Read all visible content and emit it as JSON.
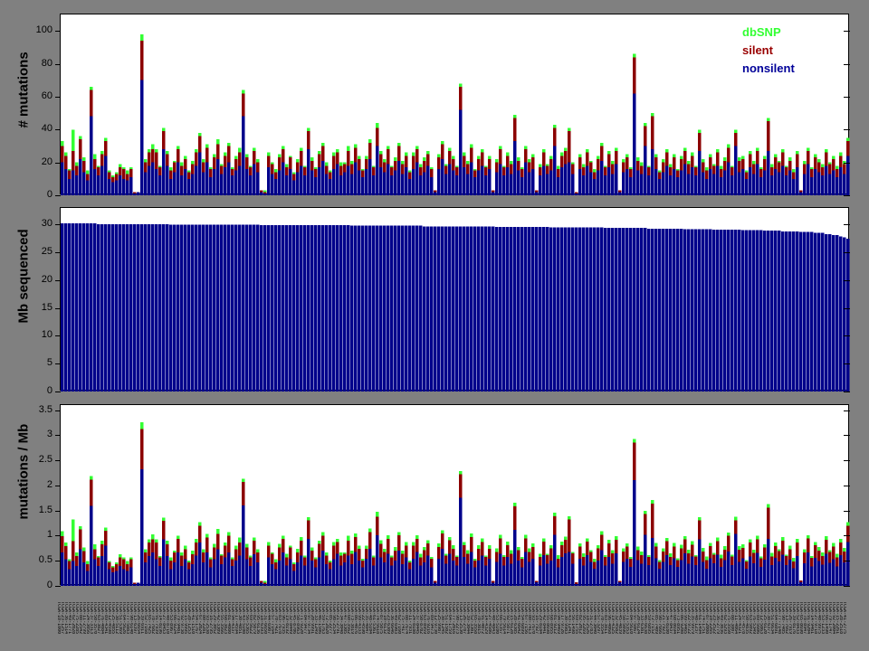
{
  "figure": {
    "background_color": "#808080",
    "plot_background_color": "#ffffff",
    "axis_color": "#000000"
  },
  "legend": {
    "items": [
      {
        "label": "dbSNP",
        "color": "#33ff33"
      },
      {
        "label": "silent",
        "color": "#990000"
      },
      {
        "label": "nonsilent",
        "color": "#000099"
      }
    ]
  },
  "x_axis": {
    "tick_labels_legible": false,
    "appearance": "dense 90-degree rotated per-sample identifiers, too small to read",
    "placeholder_prefix": "TCGA-"
  },
  "chart_data": [
    {
      "type": "bar",
      "stacked": true,
      "ylabel": "# mutations",
      "ylim": [
        0,
        110
      ],
      "yticks": [
        0,
        20,
        40,
        60,
        80,
        100
      ],
      "grid": false,
      "legend_position": "top-right inside axes, text only",
      "series_order": [
        "nonsilent",
        "silent",
        "dbSNP"
      ],
      "colors": {
        "nonsilent": "#00008b",
        "silent": "#8b0000",
        "dbSNP": "#33ff33"
      },
      "bars_format": "[nonsilent, silent, dbSNP] stacked counts per sample",
      "bars": [
        [
          20,
          10,
          3
        ],
        [
          16,
          8,
          2
        ],
        [
          10,
          5,
          1
        ],
        [
          15,
          12,
          13
        ],
        [
          12,
          6,
          2
        ],
        [
          22,
          12,
          2
        ],
        [
          14,
          7,
          2
        ],
        [
          9,
          4,
          2
        ],
        [
          48,
          16,
          2
        ],
        [
          16,
          6,
          3
        ],
        [
          12,
          5,
          1
        ],
        [
          18,
          7,
          2
        ],
        [
          24,
          9,
          2
        ],
        [
          10,
          4,
          1
        ],
        [
          8,
          3,
          1
        ],
        [
          9,
          4,
          1
        ],
        [
          12,
          5,
          2
        ],
        [
          10,
          6,
          1
        ],
        [
          9,
          4,
          2
        ],
        [
          11,
          5,
          1
        ],
        [
          1,
          1,
          0
        ],
        [
          2,
          0,
          0
        ],
        [
          70,
          24,
          4
        ],
        [
          14,
          6,
          2
        ],
        [
          18,
          8,
          2
        ],
        [
          20,
          8,
          3
        ],
        [
          16,
          10,
          2
        ],
        [
          12,
          5,
          1
        ],
        [
          28,
          11,
          2
        ],
        [
          18,
          7,
          2
        ],
        [
          10,
          5,
          2
        ],
        [
          14,
          6,
          1
        ],
        [
          20,
          8,
          2
        ],
        [
          12,
          6,
          2
        ],
        [
          16,
          6,
          2
        ],
        [
          10,
          4,
          1
        ],
        [
          13,
          6,
          2
        ],
        [
          18,
          8,
          2
        ],
        [
          26,
          10,
          2
        ],
        [
          14,
          6,
          2
        ],
        [
          20,
          9,
          2
        ],
        [
          11,
          5,
          1
        ],
        [
          16,
          7,
          2
        ],
        [
          22,
          9,
          3
        ],
        [
          13,
          5,
          1
        ],
        [
          17,
          7,
          2
        ],
        [
          20,
          10,
          2
        ],
        [
          12,
          4,
          1
        ],
        [
          15,
          7,
          2
        ],
        [
          18,
          8,
          3
        ],
        [
          48,
          14,
          2
        ],
        [
          16,
          7,
          2
        ],
        [
          12,
          5,
          1
        ],
        [
          19,
          8,
          2
        ],
        [
          14,
          6,
          2
        ],
        [
          2,
          1,
          0
        ],
        [
          1,
          1,
          1
        ],
        [
          17,
          7,
          2
        ],
        [
          13,
          6,
          1
        ],
        [
          10,
          4,
          2
        ],
        [
          15,
          8,
          2
        ],
        [
          20,
          8,
          2
        ],
        [
          12,
          5,
          2
        ],
        [
          16,
          7,
          1
        ],
        [
          9,
          4,
          1
        ],
        [
          14,
          6,
          2
        ],
        [
          18,
          9,
          2
        ],
        [
          12,
          5,
          1
        ],
        [
          28,
          11,
          2
        ],
        [
          15,
          6,
          2
        ],
        [
          11,
          5,
          1
        ],
        [
          17,
          8,
          2
        ],
        [
          21,
          9,
          2
        ],
        [
          13,
          5,
          2
        ],
        [
          10,
          4,
          1
        ],
        [
          16,
          8,
          2
        ],
        [
          19,
          7,
          2
        ],
        [
          12,
          6,
          2
        ],
        [
          14,
          5,
          1
        ],
        [
          18,
          9,
          3
        ],
        [
          13,
          6,
          2
        ],
        [
          20,
          9,
          2
        ],
        [
          15,
          7,
          2
        ],
        [
          11,
          4,
          1
        ],
        [
          16,
          6,
          2
        ],
        [
          22,
          10,
          2
        ],
        [
          12,
          5,
          1
        ],
        [
          30,
          11,
          3
        ],
        [
          17,
          8,
          2
        ],
        [
          14,
          6,
          2
        ],
        [
          19,
          9,
          2
        ],
        [
          12,
          5,
          1
        ],
        [
          15,
          6,
          2
        ],
        [
          21,
          9,
          2
        ],
        [
          13,
          6,
          2
        ],
        [
          17,
          7,
          2
        ],
        [
          10,
          4,
          1
        ],
        [
          16,
          8,
          2
        ],
        [
          20,
          8,
          2
        ],
        [
          12,
          5,
          2
        ],
        [
          14,
          7,
          2
        ],
        [
          18,
          7,
          2
        ],
        [
          11,
          5,
          1
        ],
        [
          2,
          1,
          0
        ],
        [
          16,
          7,
          2
        ],
        [
          22,
          9,
          2
        ],
        [
          13,
          5,
          1
        ],
        [
          19,
          8,
          2
        ],
        [
          15,
          7,
          2
        ],
        [
          12,
          5,
          1
        ],
        [
          52,
          14,
          2
        ],
        [
          17,
          7,
          2
        ],
        [
          13,
          6,
          2
        ],
        [
          20,
          9,
          2
        ],
        [
          11,
          4,
          1
        ],
        [
          15,
          7,
          2
        ],
        [
          18,
          8,
          2
        ],
        [
          12,
          5,
          1
        ],
        [
          16,
          6,
          2
        ],
        [
          2,
          1,
          0
        ],
        [
          14,
          6,
          2
        ],
        [
          19,
          9,
          2
        ],
        [
          12,
          5,
          1
        ],
        [
          17,
          7,
          2
        ],
        [
          13,
          6,
          2
        ],
        [
          33,
          14,
          2
        ],
        [
          15,
          6,
          2
        ],
        [
          11,
          5,
          1
        ],
        [
          20,
          8,
          2
        ],
        [
          14,
          6,
          2
        ],
        [
          16,
          7,
          2
        ],
        [
          2,
          1,
          0
        ],
        [
          12,
          5,
          2
        ],
        [
          18,
          8,
          2
        ],
        [
          13,
          5,
          1
        ],
        [
          15,
          7,
          2
        ],
        [
          30,
          11,
          2
        ],
        [
          11,
          5,
          2
        ],
        [
          17,
          7,
          2
        ],
        [
          19,
          8,
          2
        ],
        [
          20,
          19,
          2
        ],
        [
          13,
          6,
          1
        ],
        [
          1,
          1,
          0
        ],
        [
          16,
          7,
          2
        ],
        [
          12,
          5,
          2
        ],
        [
          18,
          8,
          2
        ],
        [
          14,
          6,
          1
        ],
        [
          10,
          4,
          2
        ],
        [
          15,
          7,
          2
        ],
        [
          21,
          9,
          2
        ],
        [
          12,
          5,
          1
        ],
        [
          17,
          8,
          2
        ],
        [
          13,
          6,
          2
        ],
        [
          19,
          8,
          2
        ],
        [
          2,
          1,
          0
        ],
        [
          14,
          6,
          2
        ],
        [
          16,
          7,
          2
        ],
        [
          11,
          5,
          1
        ],
        [
          62,
          22,
          2
        ],
        [
          15,
          6,
          2
        ],
        [
          13,
          5,
          2
        ],
        [
          30,
          12,
          2
        ],
        [
          12,
          5,
          1
        ],
        [
          28,
          20,
          2
        ],
        [
          16,
          7,
          2
        ],
        [
          10,
          4,
          1
        ],
        [
          14,
          6,
          2
        ],
        [
          18,
          8,
          2
        ],
        [
          12,
          5,
          2
        ],
        [
          16,
          7,
          2
        ],
        [
          11,
          4,
          1
        ],
        [
          15,
          7,
          2
        ],
        [
          19,
          8,
          2
        ],
        [
          13,
          6,
          2
        ],
        [
          17,
          7,
          2
        ],
        [
          12,
          5,
          1
        ],
        [
          27,
          11,
          2
        ],
        [
          14,
          6,
          2
        ],
        [
          10,
          5,
          2
        ],
        [
          16,
          7,
          2
        ],
        [
          13,
          5,
          1
        ],
        [
          18,
          8,
          2
        ],
        [
          11,
          5,
          2
        ],
        [
          15,
          6,
          2
        ],
        [
          20,
          9,
          2
        ],
        [
          12,
          5,
          1
        ],
        [
          30,
          8,
          2
        ],
        [
          14,
          7,
          2
        ],
        [
          16,
          6,
          2
        ],
        [
          10,
          4,
          1
        ],
        [
          17,
          8,
          2
        ],
        [
          13,
          6,
          2
        ],
        [
          19,
          8,
          2
        ],
        [
          11,
          5,
          1
        ],
        [
          15,
          7,
          2
        ],
        [
          27,
          18,
          2
        ],
        [
          12,
          5,
          2
        ],
        [
          16,
          7,
          2
        ],
        [
          14,
          6,
          1
        ],
        [
          18,
          8,
          2
        ],
        [
          12,
          5,
          1
        ],
        [
          15,
          6,
          2
        ],
        [
          10,
          4,
          2
        ],
        [
          17,
          8,
          2
        ],
        [
          2,
          1,
          0
        ],
        [
          13,
          6,
          2
        ],
        [
          19,
          8,
          2
        ],
        [
          11,
          5,
          1
        ],
        [
          16,
          7,
          2
        ],
        [
          14,
          6,
          2
        ],
        [
          12,
          5,
          2
        ],
        [
          18,
          8,
          2
        ],
        [
          13,
          6,
          1
        ],
        [
          15,
          7,
          2
        ],
        [
          11,
          5,
          2
        ],
        [
          17,
          7,
          2
        ],
        [
          13,
          6,
          2
        ],
        [
          24,
          9,
          2
        ]
      ]
    },
    {
      "type": "bar",
      "stacked": false,
      "ylabel": "Mb sequenced",
      "ylim": [
        0,
        33
      ],
      "yticks": [
        0,
        5,
        10,
        15,
        20,
        25,
        30
      ],
      "grid": false,
      "color": "#00008b",
      "values_note": "per-sample megabases sequenced, sorted roughly descending from ~30.2 to ~27.5, run-length encoded [value, count]",
      "values_runs": [
        [
          30.2,
          10
        ],
        [
          30.1,
          20
        ],
        [
          30.0,
          25
        ],
        [
          29.9,
          25
        ],
        [
          29.8,
          20
        ],
        [
          29.7,
          20
        ],
        [
          29.6,
          15
        ],
        [
          29.5,
          15
        ],
        [
          29.4,
          12
        ],
        [
          29.3,
          10
        ],
        [
          29.2,
          8
        ],
        [
          29.1,
          8
        ],
        [
          29.0,
          6
        ],
        [
          28.9,
          5
        ],
        [
          28.8,
          5
        ],
        [
          28.7,
          4
        ],
        [
          28.5,
          3
        ],
        [
          28.3,
          2
        ],
        [
          28.1,
          2
        ],
        [
          27.9,
          1
        ],
        [
          27.7,
          1
        ],
        [
          27.5,
          1
        ]
      ]
    },
    {
      "type": "bar",
      "stacked": true,
      "ylabel": "mutations / Mb",
      "ylim": [
        0,
        3.6
      ],
      "yticks": [
        0,
        0.5,
        1,
        1.5,
        2,
        2.5,
        3,
        3.5
      ],
      "grid": false,
      "series_order": [
        "nonsilent",
        "silent",
        "dbSNP"
      ],
      "colors": {
        "nonsilent": "#00008b",
        "silent": "#8b0000",
        "dbSNP": "#33ff33"
      },
      "derived": "each stacked component of panel 1 divided by the matching Mb-sequenced value of panel 2"
    }
  ]
}
